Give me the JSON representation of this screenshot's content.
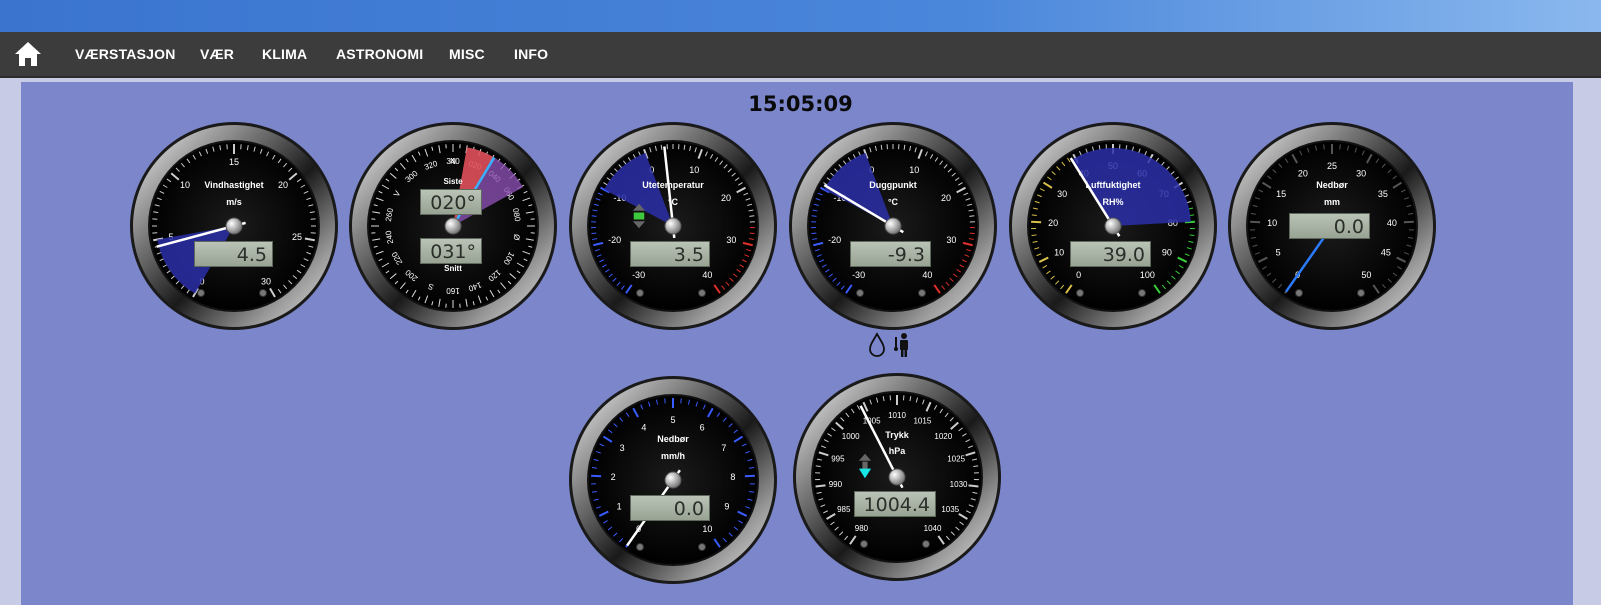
{
  "nav": {
    "home_icon": "home-icon",
    "items": [
      "VÆRSTASJON",
      "VÆR",
      "KLIMA",
      "ASTRONOMI",
      "MISC",
      "INFO"
    ]
  },
  "clock": "15:05:09",
  "colors": {
    "panel": "#7b86cb",
    "navbar": "#3c3c3c",
    "needle": "#ffffff",
    "range": "#2a2fa8"
  },
  "gauges": {
    "wind": {
      "title": "Vindhastighet",
      "unit": "m/s",
      "value": "4.5",
      "ticks": [
        "0",
        "5",
        "10",
        "15",
        "20",
        "25",
        "30"
      ],
      "level": 4.5,
      "min": 0,
      "max": 30
    },
    "direction": {
      "label_last": "Siste",
      "label_avg": "Snitt",
      "value_last": "020°",
      "value_avg": "031°",
      "ticks": [
        "N",
        "020",
        "040",
        "060",
        "080",
        "Ø",
        "100",
        "120",
        "140",
        "160",
        "S",
        "200",
        "220",
        "240",
        "260",
        "V",
        "300",
        "320",
        "340"
      ],
      "last_deg": 20,
      "avg_deg": 31
    },
    "temperature": {
      "title": "Utetemperatur",
      "unit": "°C",
      "value": "3.5",
      "ticks": [
        "-30",
        "-20",
        "-10",
        "0",
        "10",
        "20",
        "30",
        "40"
      ],
      "trend_icon": "trend-steady-icon",
      "level": 3.5,
      "min": -30,
      "max": 40
    },
    "dewpoint": {
      "title": "Duggpunkt",
      "unit": "°C",
      "value": "-9.3",
      "ticks": [
        "-30",
        "-20",
        "-10",
        "0",
        "10",
        "20",
        "30",
        "40"
      ],
      "level": -9.3,
      "min": -30,
      "max": 40
    },
    "humidity": {
      "title": "Luftfuktighet",
      "unit": "RH%",
      "value": "39.0",
      "ticks": [
        "0",
        "10",
        "20",
        "30",
        "40",
        "50",
        "60",
        "70",
        "80",
        "90",
        "100"
      ],
      "level": 39,
      "min": 0,
      "max": 100
    },
    "rain": {
      "title": "Nedbør",
      "unit": "mm",
      "value": "0.0",
      "ticks": [
        "0",
        "5",
        "10",
        "15",
        "20",
        "25",
        "30",
        "35",
        "40",
        "45",
        "50"
      ],
      "level": 0,
      "min": 0,
      "max": 50
    },
    "rainrate": {
      "title": "Nedbør",
      "unit": "mm/h",
      "value": "0.0",
      "ticks": [
        "0",
        "1",
        "2",
        "3",
        "4",
        "5",
        "6",
        "7",
        "8",
        "9",
        "10"
      ],
      "level": 0,
      "min": 0,
      "max": 10
    },
    "pressure": {
      "title": "Trykk",
      "unit": "hPa",
      "value": "1004.4",
      "ticks": [
        "980",
        "985",
        "990",
        "995",
        "1000",
        "1005",
        "1010",
        "1015",
        "1020",
        "1025",
        "1030",
        "1035",
        "1040"
      ],
      "trend_icon": "trend-down-icon",
      "level": 1004.4,
      "min": 980,
      "max": 1040
    }
  },
  "extra_icons": [
    "water-drop-icon",
    "feels-like-person-icon"
  ]
}
